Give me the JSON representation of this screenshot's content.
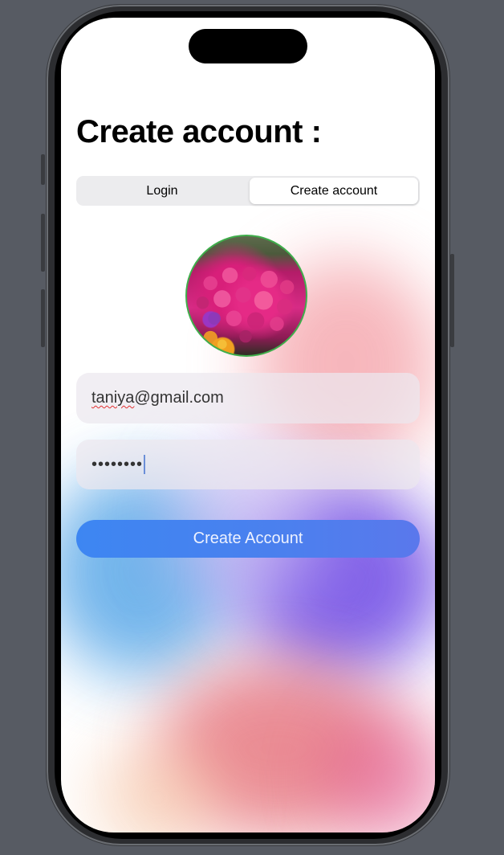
{
  "page": {
    "title": "Create account :"
  },
  "segmented_control": {
    "items": [
      {
        "label": "Login",
        "selected": false
      },
      {
        "label": "Create account",
        "selected": true
      }
    ]
  },
  "avatar": {
    "description": "flower-photo-avatar",
    "border_color": "#3fae4b"
  },
  "form": {
    "email_value": "taniya@gmail.com",
    "email_misspelled_part": "taniya",
    "email_rest": "@gmail.com",
    "password_mask": "••••••••"
  },
  "actions": {
    "create_account_label": "Create Account"
  },
  "colors": {
    "accent": "#3d86f2",
    "background_outer": "#575b63"
  }
}
